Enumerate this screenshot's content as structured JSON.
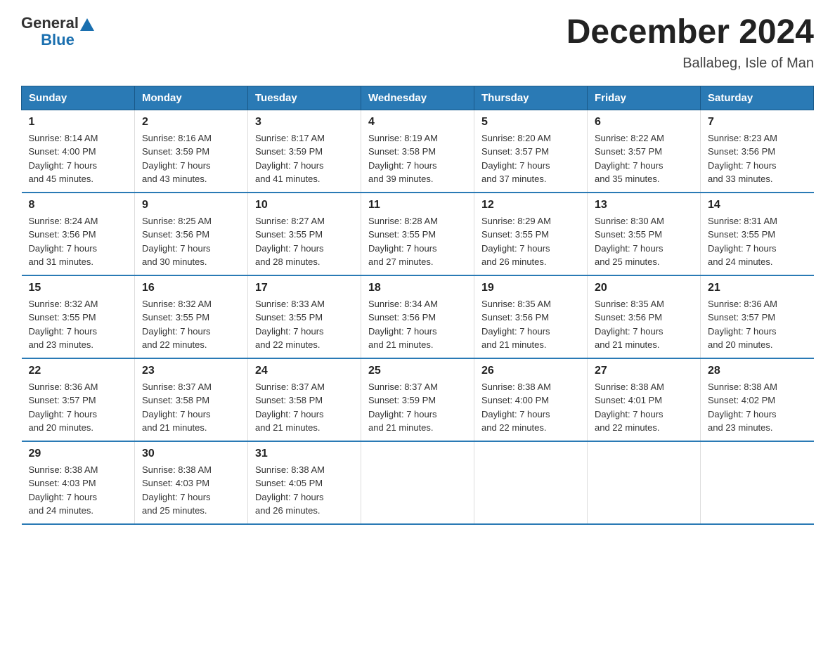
{
  "logo": {
    "general": "General",
    "blue": "Blue"
  },
  "title": "December 2024",
  "subtitle": "Ballabeg, Isle of Man",
  "days_of_week": [
    "Sunday",
    "Monday",
    "Tuesday",
    "Wednesday",
    "Thursday",
    "Friday",
    "Saturday"
  ],
  "weeks": [
    [
      {
        "day": "1",
        "info": "Sunrise: 8:14 AM\nSunset: 4:00 PM\nDaylight: 7 hours\nand 45 minutes."
      },
      {
        "day": "2",
        "info": "Sunrise: 8:16 AM\nSunset: 3:59 PM\nDaylight: 7 hours\nand 43 minutes."
      },
      {
        "day": "3",
        "info": "Sunrise: 8:17 AM\nSunset: 3:59 PM\nDaylight: 7 hours\nand 41 minutes."
      },
      {
        "day": "4",
        "info": "Sunrise: 8:19 AM\nSunset: 3:58 PM\nDaylight: 7 hours\nand 39 minutes."
      },
      {
        "day": "5",
        "info": "Sunrise: 8:20 AM\nSunset: 3:57 PM\nDaylight: 7 hours\nand 37 minutes."
      },
      {
        "day": "6",
        "info": "Sunrise: 8:22 AM\nSunset: 3:57 PM\nDaylight: 7 hours\nand 35 minutes."
      },
      {
        "day": "7",
        "info": "Sunrise: 8:23 AM\nSunset: 3:56 PM\nDaylight: 7 hours\nand 33 minutes."
      }
    ],
    [
      {
        "day": "8",
        "info": "Sunrise: 8:24 AM\nSunset: 3:56 PM\nDaylight: 7 hours\nand 31 minutes."
      },
      {
        "day": "9",
        "info": "Sunrise: 8:25 AM\nSunset: 3:56 PM\nDaylight: 7 hours\nand 30 minutes."
      },
      {
        "day": "10",
        "info": "Sunrise: 8:27 AM\nSunset: 3:55 PM\nDaylight: 7 hours\nand 28 minutes."
      },
      {
        "day": "11",
        "info": "Sunrise: 8:28 AM\nSunset: 3:55 PM\nDaylight: 7 hours\nand 27 minutes."
      },
      {
        "day": "12",
        "info": "Sunrise: 8:29 AM\nSunset: 3:55 PM\nDaylight: 7 hours\nand 26 minutes."
      },
      {
        "day": "13",
        "info": "Sunrise: 8:30 AM\nSunset: 3:55 PM\nDaylight: 7 hours\nand 25 minutes."
      },
      {
        "day": "14",
        "info": "Sunrise: 8:31 AM\nSunset: 3:55 PM\nDaylight: 7 hours\nand 24 minutes."
      }
    ],
    [
      {
        "day": "15",
        "info": "Sunrise: 8:32 AM\nSunset: 3:55 PM\nDaylight: 7 hours\nand 23 minutes."
      },
      {
        "day": "16",
        "info": "Sunrise: 8:32 AM\nSunset: 3:55 PM\nDaylight: 7 hours\nand 22 minutes."
      },
      {
        "day": "17",
        "info": "Sunrise: 8:33 AM\nSunset: 3:55 PM\nDaylight: 7 hours\nand 22 minutes."
      },
      {
        "day": "18",
        "info": "Sunrise: 8:34 AM\nSunset: 3:56 PM\nDaylight: 7 hours\nand 21 minutes."
      },
      {
        "day": "19",
        "info": "Sunrise: 8:35 AM\nSunset: 3:56 PM\nDaylight: 7 hours\nand 21 minutes."
      },
      {
        "day": "20",
        "info": "Sunrise: 8:35 AM\nSunset: 3:56 PM\nDaylight: 7 hours\nand 21 minutes."
      },
      {
        "day": "21",
        "info": "Sunrise: 8:36 AM\nSunset: 3:57 PM\nDaylight: 7 hours\nand 20 minutes."
      }
    ],
    [
      {
        "day": "22",
        "info": "Sunrise: 8:36 AM\nSunset: 3:57 PM\nDaylight: 7 hours\nand 20 minutes."
      },
      {
        "day": "23",
        "info": "Sunrise: 8:37 AM\nSunset: 3:58 PM\nDaylight: 7 hours\nand 21 minutes."
      },
      {
        "day": "24",
        "info": "Sunrise: 8:37 AM\nSunset: 3:58 PM\nDaylight: 7 hours\nand 21 minutes."
      },
      {
        "day": "25",
        "info": "Sunrise: 8:37 AM\nSunset: 3:59 PM\nDaylight: 7 hours\nand 21 minutes."
      },
      {
        "day": "26",
        "info": "Sunrise: 8:38 AM\nSunset: 4:00 PM\nDaylight: 7 hours\nand 22 minutes."
      },
      {
        "day": "27",
        "info": "Sunrise: 8:38 AM\nSunset: 4:01 PM\nDaylight: 7 hours\nand 22 minutes."
      },
      {
        "day": "28",
        "info": "Sunrise: 8:38 AM\nSunset: 4:02 PM\nDaylight: 7 hours\nand 23 minutes."
      }
    ],
    [
      {
        "day": "29",
        "info": "Sunrise: 8:38 AM\nSunset: 4:03 PM\nDaylight: 7 hours\nand 24 minutes."
      },
      {
        "day": "30",
        "info": "Sunrise: 8:38 AM\nSunset: 4:03 PM\nDaylight: 7 hours\nand 25 minutes."
      },
      {
        "day": "31",
        "info": "Sunrise: 8:38 AM\nSunset: 4:05 PM\nDaylight: 7 hours\nand 26 minutes."
      },
      {
        "day": "",
        "info": ""
      },
      {
        "day": "",
        "info": ""
      },
      {
        "day": "",
        "info": ""
      },
      {
        "day": "",
        "info": ""
      }
    ]
  ]
}
